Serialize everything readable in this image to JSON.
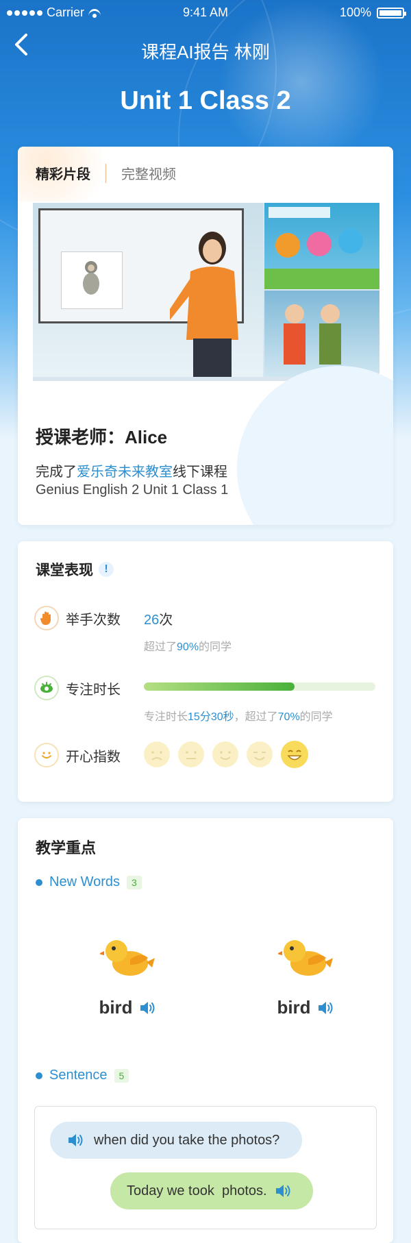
{
  "status_bar": {
    "carrier": "Carrier",
    "time": "9:41 AM",
    "battery": "100%"
  },
  "nav": {
    "title": "课程AI报告 林刚",
    "back_icon": "chevron-left-icon"
  },
  "header": {
    "course": "Unit 1 Class 2"
  },
  "video_card": {
    "tabs": [
      {
        "label": "精彩片段",
        "active": true
      },
      {
        "label": "完整视频",
        "active": false
      }
    ],
    "teacher_label": "授课老师：Alice",
    "completed_prefix": "完成了",
    "completed_highlight": "爱乐奇未来教室",
    "completed_suffix": "线下课程",
    "course_name": "Genius English 2 Unit 1 Class 1"
  },
  "performance": {
    "title": "课堂表现",
    "hand_raise": {
      "label": "举手次数",
      "value": "26",
      "unit": "次",
      "sub_prefix": "超过了",
      "sub_percent": "90%",
      "sub_suffix": "的同学"
    },
    "focus": {
      "label": "专注时长",
      "progress": 0.65,
      "sub_prefix": "专注时长",
      "sub_time": "15分30秒",
      "sub_mid": "，超过了",
      "sub_percent": "70%",
      "sub_suffix": "的同学"
    },
    "happiness": {
      "label": "开心指数",
      "faces": 5,
      "selected": 5
    }
  },
  "teaching": {
    "title": "教学重点",
    "words": {
      "label": "New Words",
      "count": "3",
      "items": [
        {
          "word": "bird"
        },
        {
          "word": "bird"
        }
      ]
    },
    "sentences": {
      "label": "Sentence",
      "count": "5",
      "q": "when did you take the photos?",
      "a": "Today we took  photos."
    }
  },
  "colors": {
    "accent": "#2d8fd0",
    "green": "#4ab13b",
    "hero": "#1a73c8"
  }
}
